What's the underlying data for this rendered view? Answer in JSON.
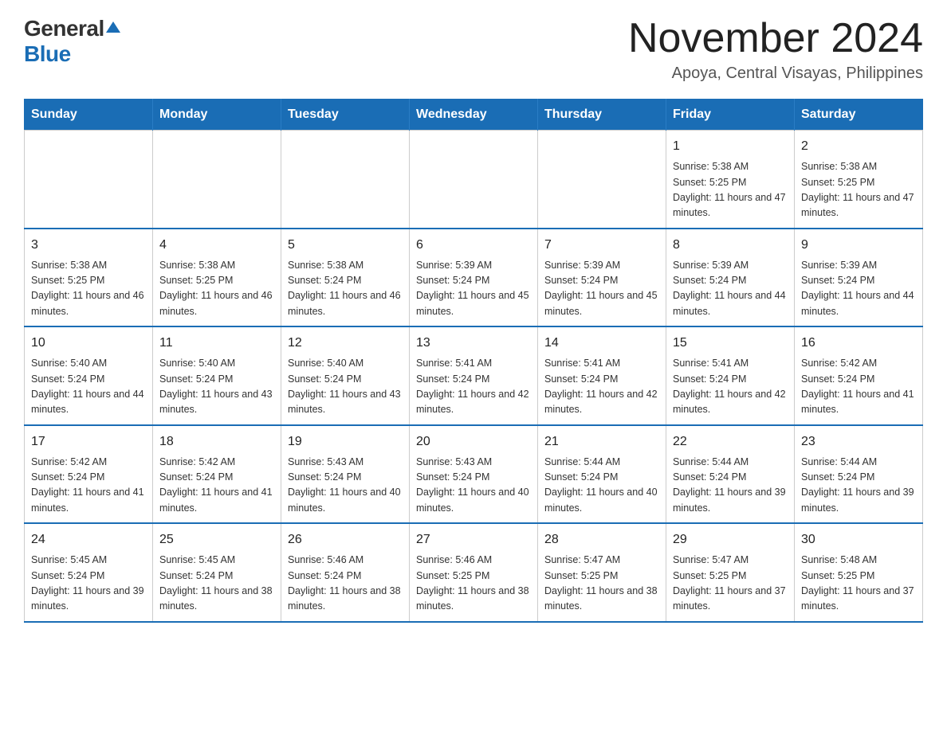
{
  "logo": {
    "general": "General",
    "blue": "Blue"
  },
  "header": {
    "month_year": "November 2024",
    "location": "Apoya, Central Visayas, Philippines"
  },
  "days_of_week": [
    "Sunday",
    "Monday",
    "Tuesday",
    "Wednesday",
    "Thursday",
    "Friday",
    "Saturday"
  ],
  "weeks": [
    [
      {
        "day": "",
        "info": ""
      },
      {
        "day": "",
        "info": ""
      },
      {
        "day": "",
        "info": ""
      },
      {
        "day": "",
        "info": ""
      },
      {
        "day": "",
        "info": ""
      },
      {
        "day": "1",
        "info": "Sunrise: 5:38 AM\nSunset: 5:25 PM\nDaylight: 11 hours and 47 minutes."
      },
      {
        "day": "2",
        "info": "Sunrise: 5:38 AM\nSunset: 5:25 PM\nDaylight: 11 hours and 47 minutes."
      }
    ],
    [
      {
        "day": "3",
        "info": "Sunrise: 5:38 AM\nSunset: 5:25 PM\nDaylight: 11 hours and 46 minutes."
      },
      {
        "day": "4",
        "info": "Sunrise: 5:38 AM\nSunset: 5:25 PM\nDaylight: 11 hours and 46 minutes."
      },
      {
        "day": "5",
        "info": "Sunrise: 5:38 AM\nSunset: 5:24 PM\nDaylight: 11 hours and 46 minutes."
      },
      {
        "day": "6",
        "info": "Sunrise: 5:39 AM\nSunset: 5:24 PM\nDaylight: 11 hours and 45 minutes."
      },
      {
        "day": "7",
        "info": "Sunrise: 5:39 AM\nSunset: 5:24 PM\nDaylight: 11 hours and 45 minutes."
      },
      {
        "day": "8",
        "info": "Sunrise: 5:39 AM\nSunset: 5:24 PM\nDaylight: 11 hours and 44 minutes."
      },
      {
        "day": "9",
        "info": "Sunrise: 5:39 AM\nSunset: 5:24 PM\nDaylight: 11 hours and 44 minutes."
      }
    ],
    [
      {
        "day": "10",
        "info": "Sunrise: 5:40 AM\nSunset: 5:24 PM\nDaylight: 11 hours and 44 minutes."
      },
      {
        "day": "11",
        "info": "Sunrise: 5:40 AM\nSunset: 5:24 PM\nDaylight: 11 hours and 43 minutes."
      },
      {
        "day": "12",
        "info": "Sunrise: 5:40 AM\nSunset: 5:24 PM\nDaylight: 11 hours and 43 minutes."
      },
      {
        "day": "13",
        "info": "Sunrise: 5:41 AM\nSunset: 5:24 PM\nDaylight: 11 hours and 42 minutes."
      },
      {
        "day": "14",
        "info": "Sunrise: 5:41 AM\nSunset: 5:24 PM\nDaylight: 11 hours and 42 minutes."
      },
      {
        "day": "15",
        "info": "Sunrise: 5:41 AM\nSunset: 5:24 PM\nDaylight: 11 hours and 42 minutes."
      },
      {
        "day": "16",
        "info": "Sunrise: 5:42 AM\nSunset: 5:24 PM\nDaylight: 11 hours and 41 minutes."
      }
    ],
    [
      {
        "day": "17",
        "info": "Sunrise: 5:42 AM\nSunset: 5:24 PM\nDaylight: 11 hours and 41 minutes."
      },
      {
        "day": "18",
        "info": "Sunrise: 5:42 AM\nSunset: 5:24 PM\nDaylight: 11 hours and 41 minutes."
      },
      {
        "day": "19",
        "info": "Sunrise: 5:43 AM\nSunset: 5:24 PM\nDaylight: 11 hours and 40 minutes."
      },
      {
        "day": "20",
        "info": "Sunrise: 5:43 AM\nSunset: 5:24 PM\nDaylight: 11 hours and 40 minutes."
      },
      {
        "day": "21",
        "info": "Sunrise: 5:44 AM\nSunset: 5:24 PM\nDaylight: 11 hours and 40 minutes."
      },
      {
        "day": "22",
        "info": "Sunrise: 5:44 AM\nSunset: 5:24 PM\nDaylight: 11 hours and 39 minutes."
      },
      {
        "day": "23",
        "info": "Sunrise: 5:44 AM\nSunset: 5:24 PM\nDaylight: 11 hours and 39 minutes."
      }
    ],
    [
      {
        "day": "24",
        "info": "Sunrise: 5:45 AM\nSunset: 5:24 PM\nDaylight: 11 hours and 39 minutes."
      },
      {
        "day": "25",
        "info": "Sunrise: 5:45 AM\nSunset: 5:24 PM\nDaylight: 11 hours and 38 minutes."
      },
      {
        "day": "26",
        "info": "Sunrise: 5:46 AM\nSunset: 5:24 PM\nDaylight: 11 hours and 38 minutes."
      },
      {
        "day": "27",
        "info": "Sunrise: 5:46 AM\nSunset: 5:25 PM\nDaylight: 11 hours and 38 minutes."
      },
      {
        "day": "28",
        "info": "Sunrise: 5:47 AM\nSunset: 5:25 PM\nDaylight: 11 hours and 38 minutes."
      },
      {
        "day": "29",
        "info": "Sunrise: 5:47 AM\nSunset: 5:25 PM\nDaylight: 11 hours and 37 minutes."
      },
      {
        "day": "30",
        "info": "Sunrise: 5:48 AM\nSunset: 5:25 PM\nDaylight: 11 hours and 37 minutes."
      }
    ]
  ]
}
